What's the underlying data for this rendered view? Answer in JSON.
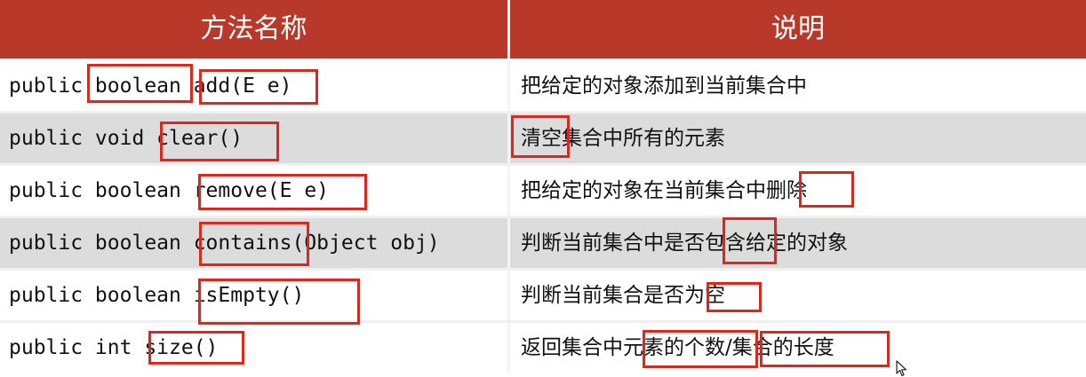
{
  "header": {
    "method_name": "方法名称",
    "description": "说明"
  },
  "rows": [
    {
      "method": "public boolean add(E e)",
      "description": "把给定的对象添加到当前集合中"
    },
    {
      "method": "public void clear()",
      "description": "清空集合中所有的元素"
    },
    {
      "method": "public boolean remove(E e)",
      "description": "把给定的对象在当前集合中删除"
    },
    {
      "method": "public boolean contains(Object obj)",
      "description": "判断当前集合中是否包含给定的对象"
    },
    {
      "method": "public boolean isEmpty()",
      "description": "判断当前集合是否为空"
    },
    {
      "method": "public int size()",
      "description": "返回集合中元素的个数/集合的长度"
    }
  ],
  "colors": {
    "header_bg": "#b8382a",
    "highlight_box": "#e0261b",
    "alt_row_bg": "#dcdcdc"
  }
}
